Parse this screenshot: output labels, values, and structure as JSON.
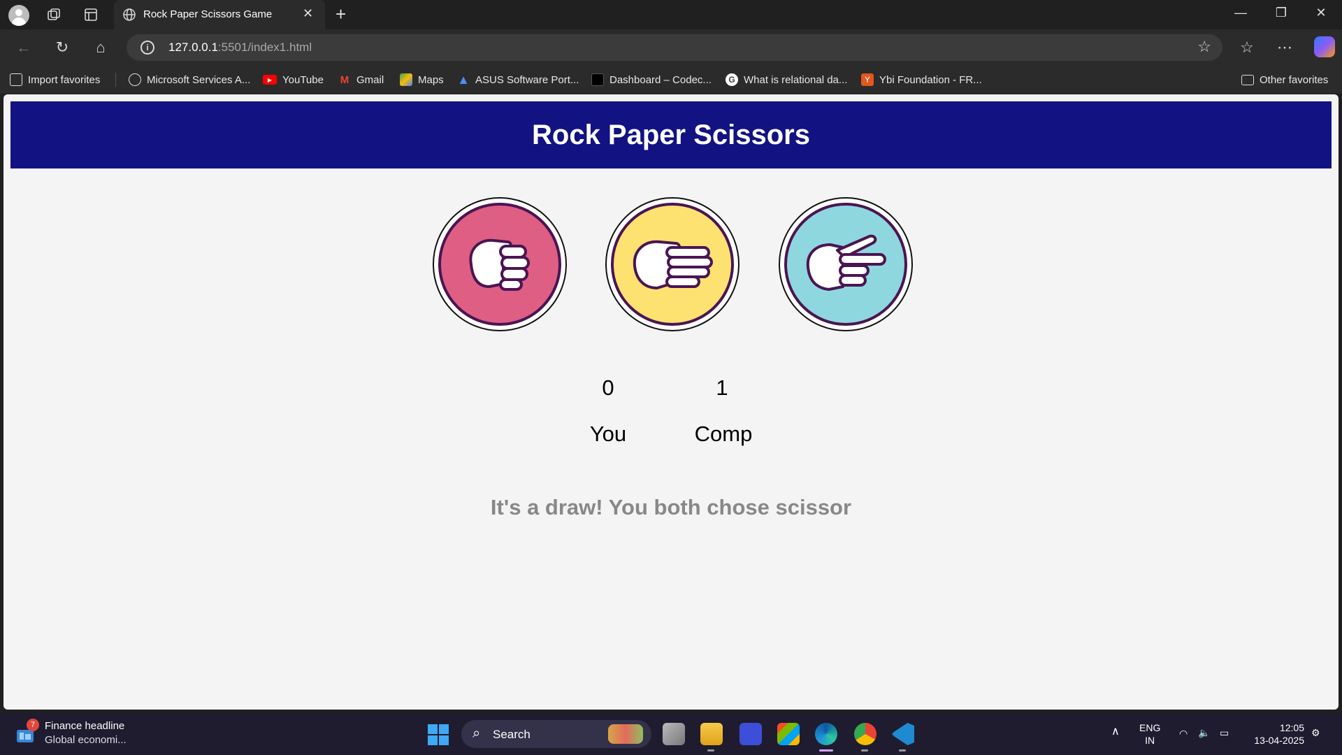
{
  "browser": {
    "tab_title": "Rock Paper Scissors Game",
    "url_host": "127.0.0.1",
    "url_rest": ":5501/index1.html"
  },
  "favorites": [
    {
      "label": "Import favorites",
      "icon": "import-icon"
    },
    {
      "label": "Microsoft Services A...",
      "icon": "globe-icon"
    },
    {
      "label": "YouTube",
      "icon": "youtube-icon",
      "color": "#ff0000"
    },
    {
      "label": "Gmail",
      "icon": "gmail-icon",
      "color": "#ea4335"
    },
    {
      "label": "Maps",
      "icon": "maps-icon",
      "color": "#34a853"
    },
    {
      "label": "ASUS Software Port...",
      "icon": "asus-icon",
      "color": "#4f8ff7"
    },
    {
      "label": "Dashboard – Codec...",
      "icon": "codec-icon",
      "color": "#000000"
    },
    {
      "label": "What is relational da...",
      "icon": "google-icon",
      "color": "#ffffff"
    },
    {
      "label": "Ybi Foundation - FR...",
      "icon": "ybi-icon",
      "color": "#e2571e"
    },
    {
      "label": "Other favorites",
      "icon": "folder-icon"
    }
  ],
  "game": {
    "title": "Rock Paper Scissors",
    "choices": [
      {
        "name": "rock",
        "color": "#df5e84"
      },
      {
        "name": "paper",
        "color": "#fde272"
      },
      {
        "name": "scissors",
        "color": "#8fd7df"
      }
    ],
    "user_score": "0",
    "comp_score": "1",
    "user_label": "You",
    "comp_label": "Comp",
    "message": "It's a draw! You both chose scissor",
    "outline_color": "#4a1553",
    "header_color": "#121283"
  },
  "taskbar": {
    "news_title": "Finance headline",
    "news_sub": "Global economi...",
    "widget_badge": "7",
    "search_label": "Search",
    "lang_top": "ENG",
    "lang_bottom": "IN",
    "time": "12:05",
    "date": "13-04-2025"
  }
}
